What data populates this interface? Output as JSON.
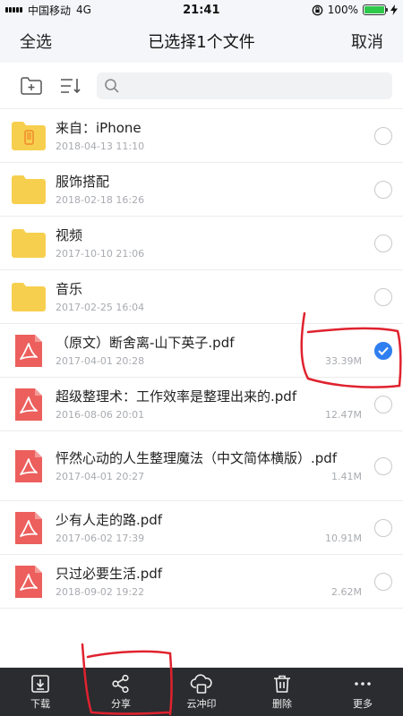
{
  "status_bar": {
    "carrier": "中国移动",
    "network": "4G",
    "time": "21:41",
    "battery": "100%",
    "battery_level": 1.0
  },
  "nav": {
    "select_all": "全选",
    "title": "已选择1个文件",
    "cancel": "取消"
  },
  "files": [
    {
      "name": "来自：iPhone",
      "date": "2018-04-13 11:10",
      "size": "",
      "type": "folder-phone",
      "checked": false
    },
    {
      "name": "服饰搭配",
      "date": "2018-02-18 16:26",
      "size": "",
      "type": "folder",
      "checked": false
    },
    {
      "name": "视频",
      "date": "2017-10-10 21:06",
      "size": "",
      "type": "folder",
      "checked": false
    },
    {
      "name": "音乐",
      "date": "2017-02-25 16:04",
      "size": "",
      "type": "folder",
      "checked": false
    },
    {
      "name": "（原文）断舍离-山下英子.pdf",
      "date": "2017-04-01 20:28",
      "size": "33.39M",
      "type": "pdf",
      "checked": true
    },
    {
      "name": "超级整理术：工作效率是整理出来的.pdf",
      "date": "2016-08-06 20:01",
      "size": "12.47M",
      "type": "pdf",
      "checked": false
    },
    {
      "name": "怦然心动的人生整理魔法（中文简体横版）.pdf",
      "date": "2017-04-01 20:27",
      "size": "1.41M",
      "type": "pdf",
      "checked": false
    },
    {
      "name": "少有人走的路.pdf",
      "date": "2017-06-02 17:39",
      "size": "10.91M",
      "type": "pdf",
      "checked": false
    },
    {
      "name": "只过必要生活.pdf",
      "date": "2018-09-02 19:22",
      "size": "2.62M",
      "type": "pdf",
      "checked": false
    }
  ],
  "bottom_bar": {
    "download": "下载",
    "share": "分享",
    "cloud_print": "云冲印",
    "delete": "删除",
    "more": "更多"
  },
  "colors": {
    "folder": "#f7cf4e",
    "pdf": "#ec5f5c",
    "check": "#2f7ff0",
    "annotation": "#e0222e"
  }
}
